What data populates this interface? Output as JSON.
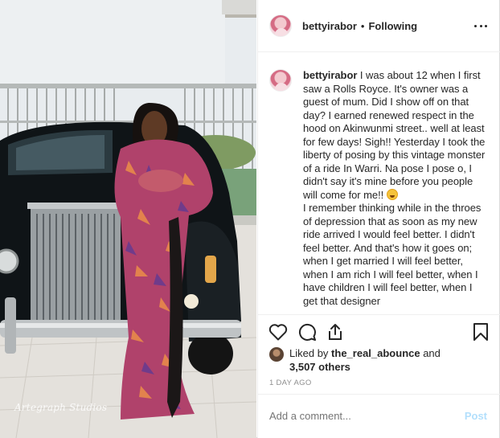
{
  "post": {
    "username": "bettyirabor",
    "separator": "•",
    "follow_status": "Following",
    "caption_user": "bettyirabor",
    "caption_part1": " I was about 12 when I first saw a Rolls Royce. It's owner was a guest of mum. Did I show off on that day? I earned renewed respect in the hood on Akinwunmi street.. well at least for few days! Sigh!! Yesterday I took the liberty of posing by this vintage monster of a ride In Warri. Na pose I pose o, I didn't say it's mine before you people will come for me!! ",
    "caption_emoji": "laughing-face-icon",
    "caption_part2": "I remember thinking while in the throes of depression that as soon as my new ride arrived I would feel better. I didn't feel better. And that's how it goes on; when I get married I will feel better, when I am rich I will feel better, when I have children I will feel better, when I get that designer",
    "liked_by_prefix": "Liked by ",
    "liked_by_user": "the_real_abounce",
    "liked_by_middle": " and",
    "liked_by_others": "3,507 others",
    "timestamp": "1 DAY AGO",
    "watermark": "Artegraph Studios"
  },
  "comment": {
    "placeholder": "Add a comment...",
    "post_label": "Post"
  },
  "icons": {
    "more": "more-options-icon",
    "like": "heart-icon",
    "comment": "comment-icon",
    "share": "share-icon",
    "save": "bookmark-icon"
  },
  "colors": {
    "text": "#262626",
    "muted": "#8e8e8e",
    "border": "#efefef",
    "post_disabled": "#b2dffc"
  }
}
